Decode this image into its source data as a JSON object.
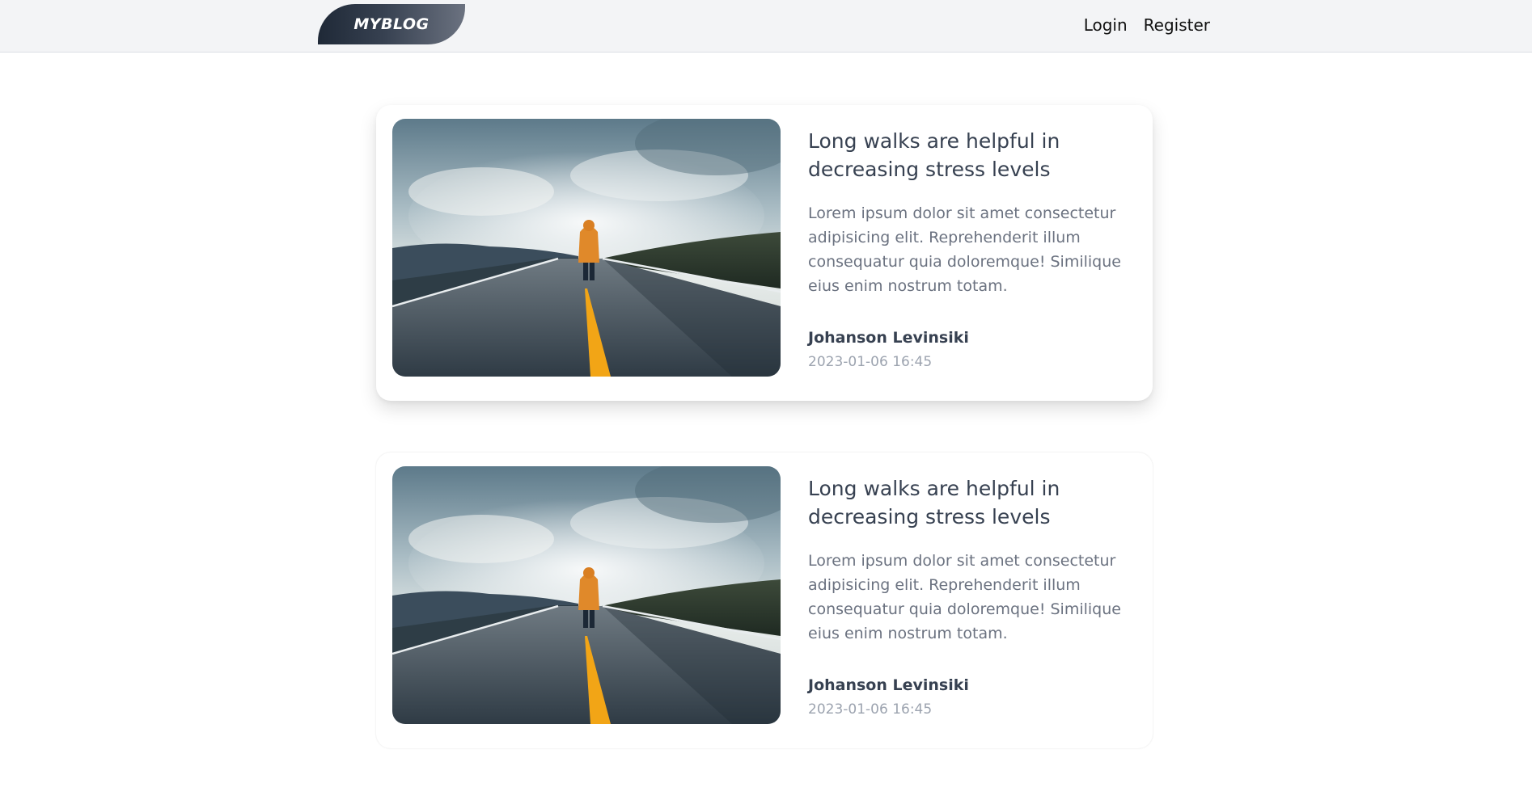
{
  "navbar": {
    "logo_text": "MYBLOG",
    "links": [
      {
        "label": "Login"
      },
      {
        "label": "Register"
      }
    ]
  },
  "posts": [
    {
      "title": "Long walks are helpful in decreasing stress levels",
      "excerpt": "Lorem ipsum dolor sit amet consectetur adipisicing elit. Reprehenderit illum consequatur quia doloremque! Similique eius enim nostrum totam.",
      "author": "Johanson Levinsiki",
      "date": "2023-01-06 16:45"
    },
    {
      "title": "Long walks are helpful in decreasing stress levels",
      "excerpt": "Lorem ipsum dolor sit amet consectetur adipisicing elit. Reprehenderit illum consequatur quia doloremque! Similique eius enim nostrum totam.",
      "author": "Johanson Levinsiki",
      "date": "2023-01-06 16:45"
    }
  ],
  "colors": {
    "navbar_bg": "#f3f4f6",
    "title_text": "#374151",
    "excerpt_text": "#6b7280",
    "date_text": "#9ca3af",
    "road_line": "#f2a516",
    "jacket": "#e0892a"
  }
}
